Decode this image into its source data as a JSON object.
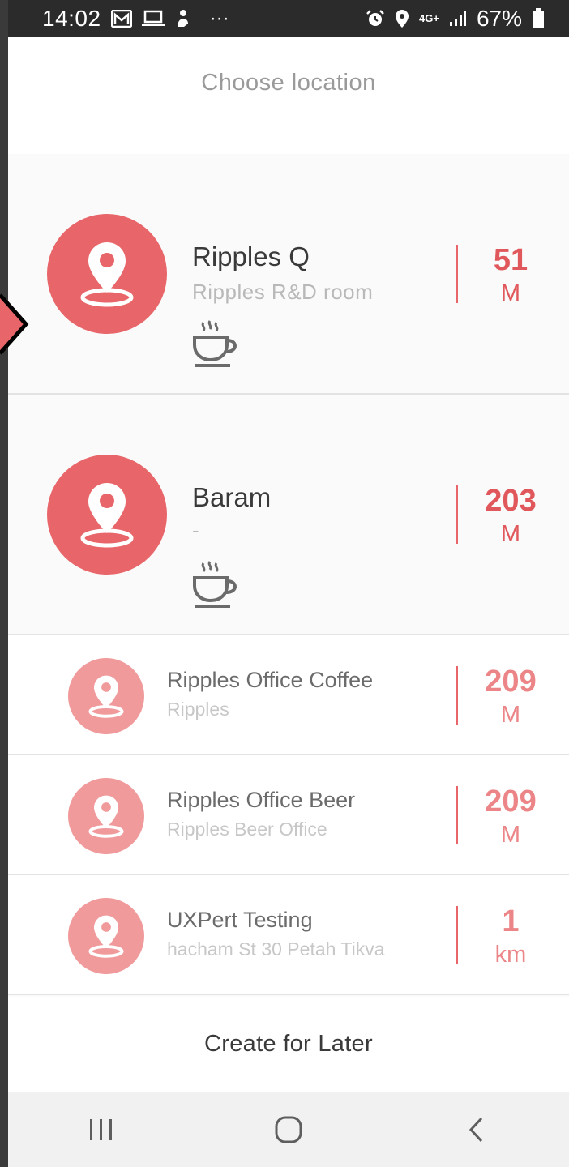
{
  "status_bar": {
    "time": "14:02",
    "network": "4G+",
    "battery": "67%",
    "icons": [
      "gmail-icon",
      "laptop-icon",
      "person-icon",
      "more-dots-icon",
      "alarm-icon",
      "location-icon",
      "signal-icon",
      "battery-icon"
    ]
  },
  "header": {
    "title": "Choose location"
  },
  "locations": [
    {
      "name": "Ripples Q",
      "subtitle": "Ripples  R&D  room",
      "distance": "51",
      "unit": "M",
      "icon": "location-pin-icon",
      "feature_icon": "coffee-cup-icon"
    },
    {
      "name": "Baram",
      "subtitle": "-",
      "distance": "203",
      "unit": "M",
      "icon": "location-pin-icon",
      "feature_icon": "coffee-cup-icon"
    },
    {
      "name": "Ripples Office Coffee",
      "subtitle": "Ripples",
      "distance": "209",
      "unit": "M",
      "icon": "location-pin-icon"
    },
    {
      "name": "Ripples Office Beer",
      "subtitle": "Ripples Beer Office",
      "distance": "209",
      "unit": "M",
      "icon": "location-pin-icon"
    },
    {
      "name": "UXPert Testing",
      "subtitle": "hacham St 30 Petah Tikva",
      "distance": "1",
      "unit": "km",
      "icon": "location-pin-icon"
    }
  ],
  "footer": {
    "button_label": "Create for Later"
  },
  "nav_bar": {
    "buttons": [
      "recents-icon",
      "home-icon",
      "back-icon"
    ]
  },
  "colors": {
    "accent": "#e8666a",
    "accent_light": "#f09a9b",
    "text_dark": "#3a3a3a",
    "text_muted": "#b9b9b9"
  }
}
